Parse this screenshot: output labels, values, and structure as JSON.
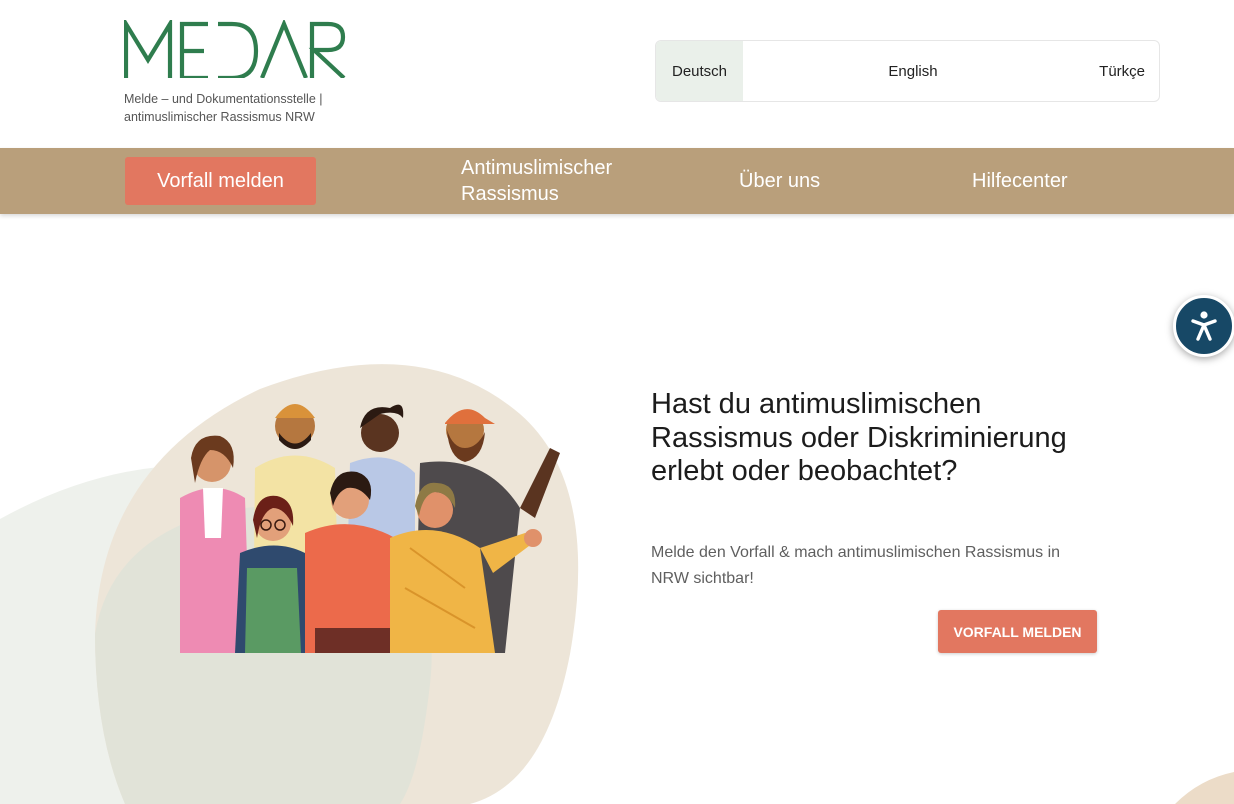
{
  "header": {
    "logo_text": "MEDAR",
    "logo_subtitle_line1": "Melde – und Dokumentationsstelle |",
    "logo_subtitle_line2": "antimuslimischer Rassismus NRW",
    "languages": [
      "Deutsch",
      "English",
      "Türkçe"
    ],
    "active_language": "Deutsch"
  },
  "nav": {
    "cta_label": "Vorfall melden",
    "links": [
      "Antimuslimischer Rassismus",
      "Über uns",
      "Hilfecenter"
    ]
  },
  "hero": {
    "title": "Hast du antimuslimischen Rassismus oder Diskriminierung erlebt oder beobachtet?",
    "subtitle": "Melde den Vorfall & mach antimuslimischen Rassismus in NRW sichtbar!",
    "cta_label": "VORFALL MELDEN"
  },
  "colors": {
    "brand_green": "#2f7d4e",
    "nav_bg": "#b99f7b",
    "accent": "#e27760",
    "a11y_blue": "#174866"
  },
  "icons": {
    "accessibility": "accessibility-icon"
  }
}
